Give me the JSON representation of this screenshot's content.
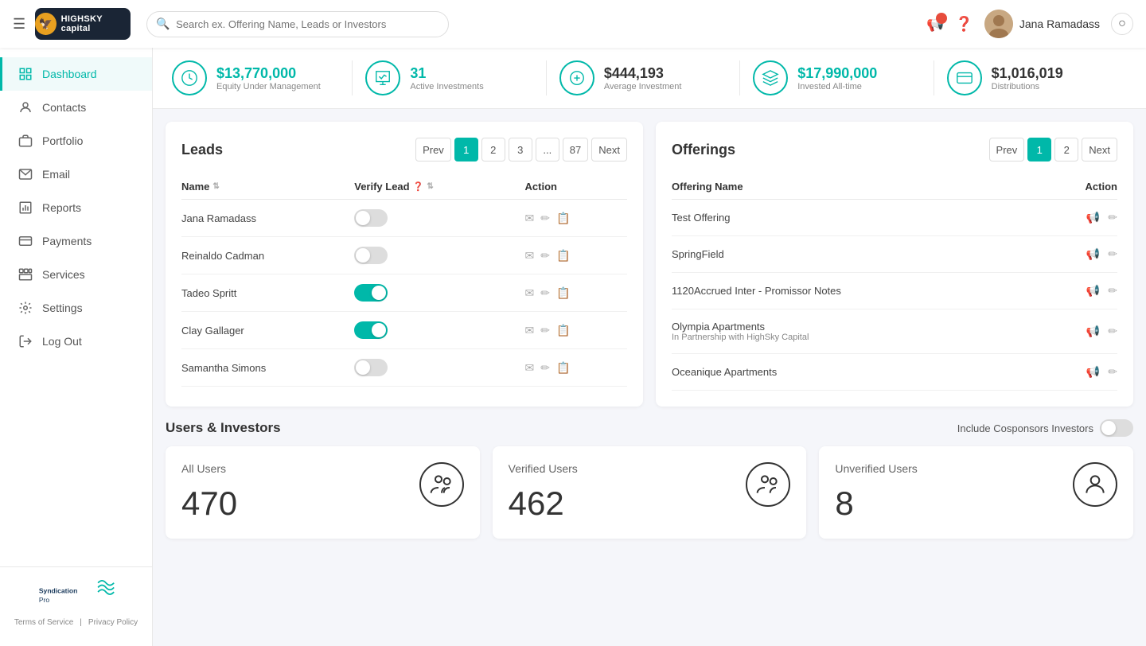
{
  "topnav": {
    "logo_text": "HIGHSKY capital",
    "search_placeholder": "Search ex. Offering Name, Leads or Investors",
    "user_name": "Jana Ramadass"
  },
  "stats": [
    {
      "id": "equity",
      "value": "$13,770,000",
      "label": "Equity Under Management",
      "green": true
    },
    {
      "id": "active",
      "value": "31",
      "label": "Active Investments",
      "green": true
    },
    {
      "id": "average",
      "value": "$444,193",
      "label": "Average Investment",
      "green": false
    },
    {
      "id": "invested",
      "value": "$17,990,000",
      "label": "Invested All-time",
      "green": true
    },
    {
      "id": "distributions",
      "value": "$1,016,019",
      "label": "Distributions",
      "green": false
    }
  ],
  "leads": {
    "title": "Leads",
    "pagination": {
      "prev_label": "Prev",
      "next_label": "Next",
      "pages": [
        "1",
        "2",
        "3",
        "...",
        "87"
      ],
      "active_page": "1"
    },
    "columns": [
      "Name",
      "Verify Lead",
      "Action"
    ],
    "rows": [
      {
        "name": "Jana Ramadass",
        "verified": false
      },
      {
        "name": "Reinaldo Cadman",
        "verified": false
      },
      {
        "name": "Tadeo Spritt",
        "verified": true
      },
      {
        "name": "Clay Gallager",
        "verified": true
      },
      {
        "name": "Samantha Simons",
        "verified": false
      }
    ]
  },
  "offerings": {
    "title": "Offerings",
    "pagination": {
      "prev_label": "Prev",
      "next_label": "Next",
      "pages": [
        "1",
        "2"
      ],
      "active_page": "1"
    },
    "columns": [
      "Offering Name",
      "Action"
    ],
    "rows": [
      {
        "name": "Test Offering",
        "sub": ""
      },
      {
        "name": "SpringField",
        "sub": ""
      },
      {
        "name": "1120Accrued Inter - Promissor Notes",
        "sub": ""
      },
      {
        "name": "Olympia Apartments",
        "sub": "In Partnership with HighSky Capital"
      },
      {
        "name": "Oceanique Apartments",
        "sub": ""
      }
    ]
  },
  "users_investors": {
    "title": "Users & Investors",
    "cosponsors_label": "Include Cosponsors Investors",
    "cards": [
      {
        "label": "All Users",
        "value": "470"
      },
      {
        "label": "Verified Users",
        "value": "462"
      },
      {
        "label": "Unverified Users",
        "value": "8"
      }
    ]
  },
  "sidebar": {
    "items": [
      {
        "id": "dashboard",
        "label": "Dashboard",
        "active": true
      },
      {
        "id": "contacts",
        "label": "Contacts",
        "active": false
      },
      {
        "id": "portfolio",
        "label": "Portfolio",
        "active": false
      },
      {
        "id": "email",
        "label": "Email",
        "active": false
      },
      {
        "id": "reports",
        "label": "Reports",
        "active": false
      },
      {
        "id": "payments",
        "label": "Payments",
        "active": false
      },
      {
        "id": "services",
        "label": "Services",
        "active": false
      },
      {
        "id": "settings",
        "label": "Settings",
        "active": false
      },
      {
        "id": "logout",
        "label": "Log Out",
        "active": false
      }
    ],
    "footer": {
      "brand": "SyndicationPro",
      "terms": "Terms of Service",
      "privacy": "Privacy Policy"
    }
  }
}
